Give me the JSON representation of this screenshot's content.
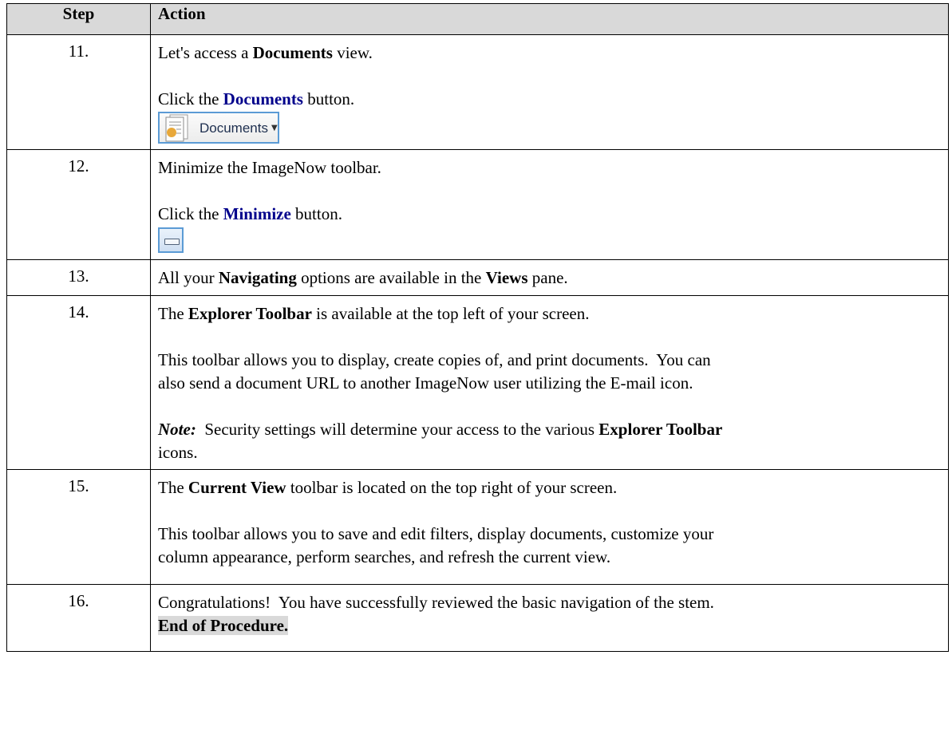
{
  "headers": {
    "step": "Step",
    "action": "Action"
  },
  "rows": [
    {
      "step": "11.",
      "line1": [
        "Let's access a ",
        "Documents",
        " view."
      ],
      "line2": [
        "Click the ",
        "Documents",
        " button."
      ],
      "button_label": "Documents"
    },
    {
      "step": "12.",
      "line1": "Minimize the ImageNow toolbar.",
      "line2": [
        "Click the ",
        "Minimize",
        " button."
      ]
    },
    {
      "step": "13.",
      "line1": [
        "All your ",
        "Navigating",
        " options are available in the ",
        "Views",
        " pane."
      ]
    },
    {
      "step": "14.",
      "line1": [
        "The ",
        "Explorer Toolbar",
        " is available at the top left of your screen."
      ],
      "para2_a": "This toolbar allows you to display, create copies of, and print documents.  You can",
      "para2_b": "also send a document URL to another ImageNow user utilizing the E-mail icon.",
      "note_label": "Note:",
      "note_a": "  Security settings will determine your access to the various ",
      "note_bold": "Explorer Toolbar",
      "note_b": "icons."
    },
    {
      "step": "15.",
      "line1": [
        "The ",
        "Current View",
        " toolbar is located on the top right of your screen."
      ],
      "para2_a": "This toolbar allows you to save and edit filters, display documents, customize your",
      "para2_b": "column appearance, perform searches, and refresh the current view."
    },
    {
      "step": "16.",
      "line1": "Congratulations!  You have successfully reviewed the basic navigation of the stem.",
      "end": "End of Procedure."
    }
  ]
}
